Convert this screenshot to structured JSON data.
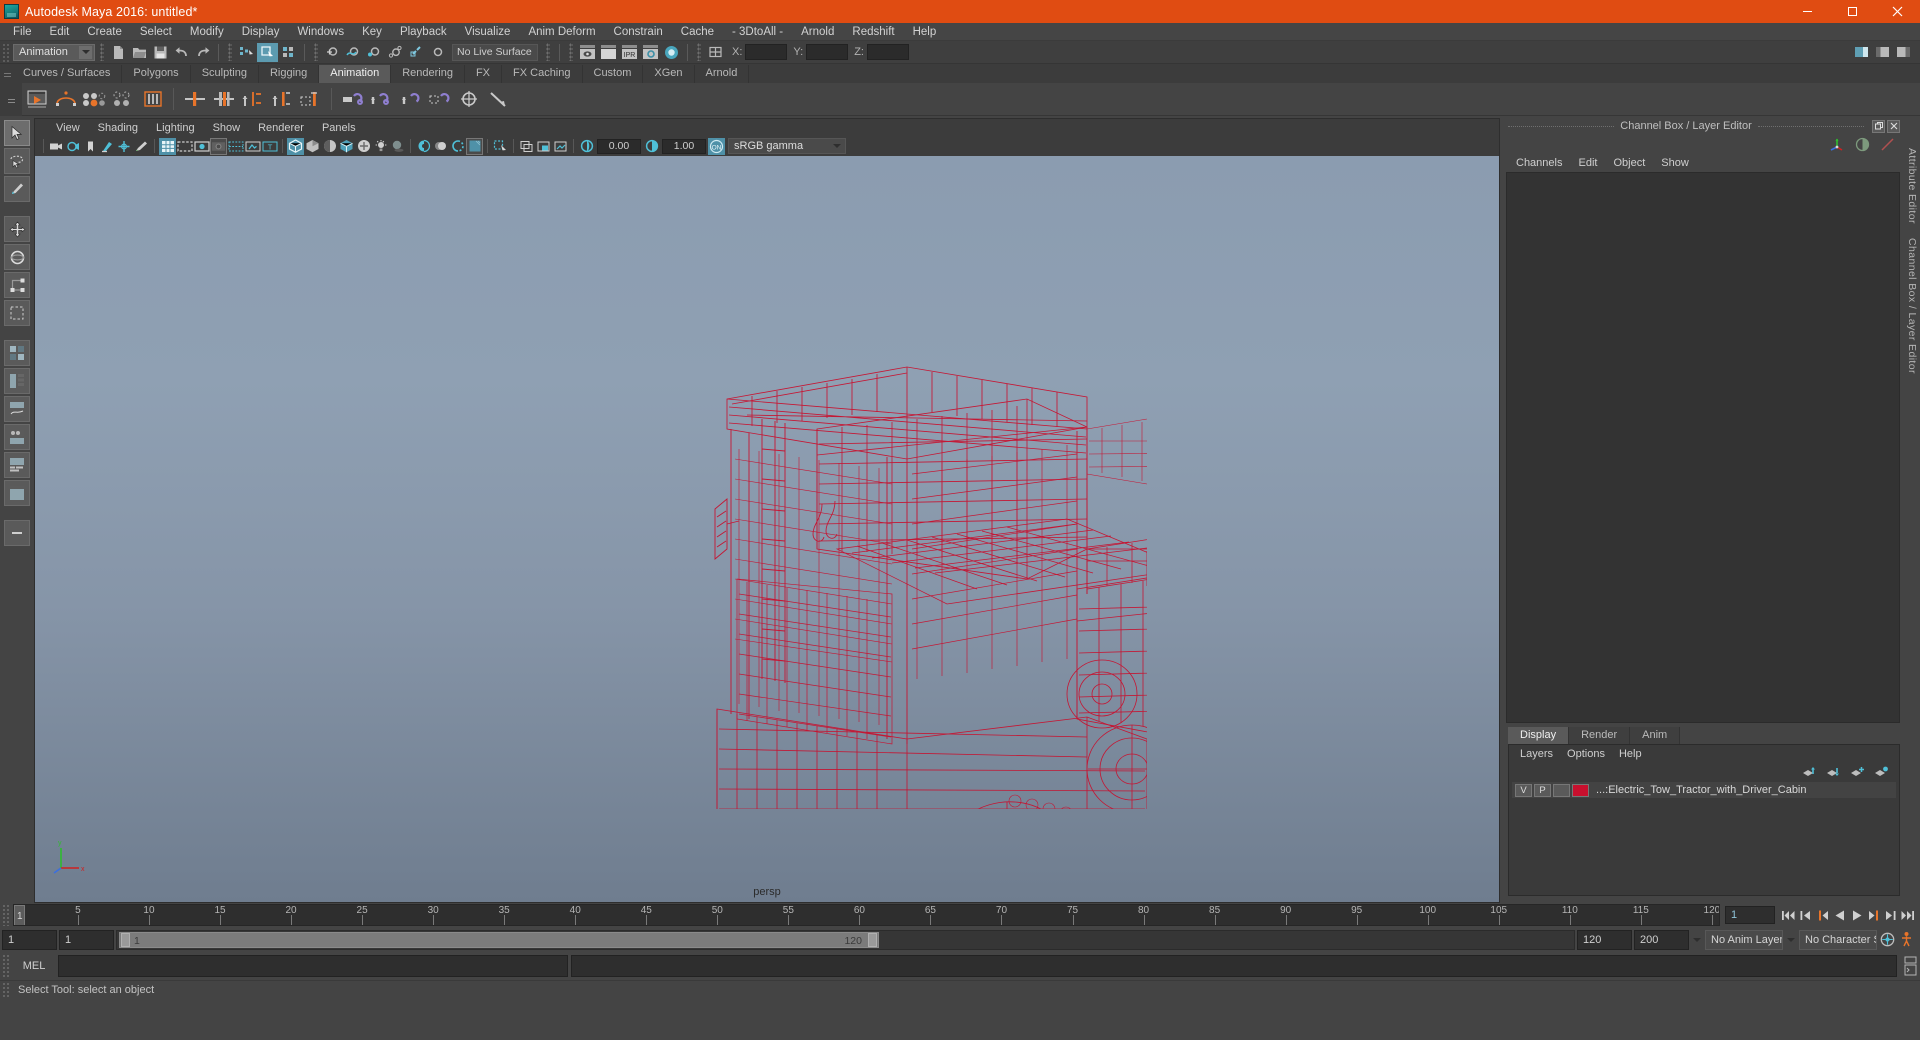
{
  "window": {
    "title": "Autodesk Maya 2016: untitled*",
    "minimize_label": "—",
    "maximize_label": "❐",
    "close_label": "✕"
  },
  "menubar": {
    "items": [
      {
        "label": "File"
      },
      {
        "label": "Edit"
      },
      {
        "label": "Create"
      },
      {
        "label": "Select"
      },
      {
        "label": "Modify"
      },
      {
        "label": "Display"
      },
      {
        "label": "Windows"
      },
      {
        "label": "Key"
      },
      {
        "label": "Playback"
      },
      {
        "label": "Visualize"
      },
      {
        "label": "Anim Deform"
      },
      {
        "label": "Constrain"
      },
      {
        "label": "Cache"
      },
      {
        "label": "- 3DtoAll -"
      },
      {
        "label": "Arnold"
      },
      {
        "label": "Redshift"
      },
      {
        "label": "Help"
      }
    ]
  },
  "statusline": {
    "menuset_value": "Animation",
    "live_surface_value": "No Live Surface",
    "coord_x_label": "X:",
    "coord_y_label": "Y:",
    "coord_z_label": "Z:",
    "coord_x_value": "",
    "coord_y_value": "",
    "coord_z_value": "",
    "ipr_label": "IPR",
    "icons": [
      "new-scene-icon",
      "open-scene-icon",
      "save-scene-icon",
      "undo-icon",
      "redo-icon",
      "select-by-hierarchy-icon",
      "select-by-object-icon",
      "select-by-component-icon",
      "snap-to-grid-icon",
      "snap-to-curve-icon",
      "snap-to-point-icon",
      "snap-to-projected-center-icon",
      "snap-to-view-plane-icon",
      "make-live-icon",
      "render-current-frame-icon",
      "ipr-render-icon",
      "render-settings-icon",
      "hypershade-icon",
      "render-view-icon"
    ]
  },
  "shelf_tabs": {
    "items": [
      {
        "label": "Curves / Surfaces"
      },
      {
        "label": "Polygons"
      },
      {
        "label": "Sculpting"
      },
      {
        "label": "Rigging"
      },
      {
        "label": "Animation"
      },
      {
        "label": "Rendering"
      },
      {
        "label": "FX"
      },
      {
        "label": "FX Caching"
      },
      {
        "label": "Custom"
      },
      {
        "label": "XGen"
      },
      {
        "label": "Arnold"
      }
    ],
    "active": "Animation"
  },
  "shelf_icons": [
    "playblast-icon",
    "ghost-selected-icon",
    "set-key-icon",
    "set-breakdown-key-icon",
    "key-channel-icon",
    "cut-keys-icon",
    "copy-keys-icon",
    "paste-keys-icon",
    "delete-keys-icon",
    "snap-keys-icon",
    "ik-handle-icon",
    "ik-spline-handle-icon",
    "constraint-icon",
    "parent-constraint-icon",
    "point-constraint-icon",
    "orient-constraint-icon",
    "scale-constraint-icon",
    "aim-constraint-icon",
    "pole-vector-icon"
  ],
  "viewport": {
    "menus": [
      {
        "label": "View"
      },
      {
        "label": "Shading"
      },
      {
        "label": "Lighting"
      },
      {
        "label": "Show"
      },
      {
        "label": "Renderer"
      },
      {
        "label": "Panels"
      }
    ],
    "camera_label": "persp",
    "exposure_value": "0.00",
    "gamma_value": "1.00",
    "color_management_value": "sRGB gamma",
    "color_management_toggle": "ON",
    "toolbar_icons": [
      "select-camera-icon",
      "lock-camera-icon",
      "bookmark-icon",
      "image-plane-icon",
      "two-d-pan-zoom-icon",
      "grease-pencil-icon",
      "grid-toggle-icon",
      "film-gate-icon",
      "resolution-gate-icon",
      "gate-mask-icon",
      "field-chart-icon",
      "safe-action-icon",
      "safe-title-icon",
      "wireframe-icon",
      "smooth-shade-icon",
      "flat-shade-icon",
      "shaded-wireframe-icon",
      "textured-icon",
      "lighting-icon",
      "shadows-icon",
      "ambient-occlusion-icon",
      "motion-blur-icon",
      "multisample-icon",
      "isolate-select-icon",
      "xray-icon",
      "xray-joints-icon",
      "xray-active-components-icon",
      "exposure-icon",
      "gamma-icon"
    ],
    "model_name": "Electric Tow Tractor with Driver Cabin",
    "wire_color": "#c8102e"
  },
  "toolbox": {
    "items": [
      {
        "name": "select-tool",
        "label": "Select Tool"
      },
      {
        "name": "lasso-tool",
        "label": "Lasso Select Tool"
      },
      {
        "name": "paint-select-tool",
        "label": "Paint Select Tool"
      },
      {
        "name": "move-tool",
        "label": "Move Tool"
      },
      {
        "name": "rotate-tool",
        "label": "Rotate Tool"
      },
      {
        "name": "scale-tool",
        "label": "Scale Tool"
      },
      {
        "name": "last-tool",
        "label": "Last Tool Used"
      },
      {
        "name": "four-view-layout",
        "label": "Four View"
      },
      {
        "name": "persp-outliner-layout",
        "label": "Persp/Outliner"
      },
      {
        "name": "persp-graph-layout",
        "label": "Persp/Graph"
      },
      {
        "name": "hypershade-persp-layout",
        "label": "Hypershade/Persp"
      },
      {
        "name": "persp-trax-layout",
        "label": "Persp/Trax"
      },
      {
        "name": "single-persp-layout",
        "label": "Single Perspective View"
      },
      {
        "name": "more-layouts",
        "label": "More layouts"
      }
    ]
  },
  "right_panel": {
    "title": "Channel Box / Layer Editor",
    "restore_label": "❐",
    "close_label": "✕",
    "channel_menus": [
      {
        "label": "Channels"
      },
      {
        "label": "Edit"
      },
      {
        "label": "Object"
      },
      {
        "label": "Show"
      }
    ],
    "tool_icons": [
      "show-manipulator-icon",
      "shader-ball-icon",
      "input-line-icon"
    ],
    "layer_tabs": [
      {
        "label": "Display"
      },
      {
        "label": "Render"
      },
      {
        "label": "Anim"
      }
    ],
    "layer_tabs_active": "Display",
    "layer_menus": [
      {
        "label": "Layers"
      },
      {
        "label": "Options"
      },
      {
        "label": "Help"
      }
    ],
    "layer_icons": [
      "move-layer-up-icon",
      "move-layer-down-icon",
      "new-layer-icon",
      "new-layer-from-selected-icon"
    ],
    "layers": [
      {
        "visibility": "V",
        "playback": "P",
        "display_type": "",
        "color": "#c8102e",
        "name": "...:Electric_Tow_Tractor_with_Driver_Cabin"
      }
    ],
    "side_tabs": [
      {
        "label": "Attribute Editor"
      },
      {
        "label": "Channel Box / Layer Editor"
      }
    ]
  },
  "time_slider": {
    "start": 1,
    "end": 120,
    "current_frame": "1",
    "tick_labels": [
      5,
      10,
      15,
      20,
      25,
      30,
      35,
      40,
      45,
      50,
      55,
      60,
      65,
      70,
      75,
      80,
      85,
      90,
      95,
      100,
      105,
      110,
      115,
      120
    ],
    "cursor_label": "1",
    "playback_buttons": [
      {
        "name": "go-to-start-button",
        "glyph": "go-to-start"
      },
      {
        "name": "step-back-frame-button",
        "glyph": "step-back"
      },
      {
        "name": "step-back-key-button",
        "glyph": "step-back-key"
      },
      {
        "name": "play-backwards-button",
        "glyph": "play-back"
      },
      {
        "name": "play-forwards-button",
        "glyph": "play-fwd"
      },
      {
        "name": "step-forward-key-button",
        "glyph": "step-fwd-key"
      },
      {
        "name": "step-forward-frame-button",
        "glyph": "step-fwd"
      },
      {
        "name": "go-to-end-button",
        "glyph": "go-to-end"
      }
    ]
  },
  "range_slider": {
    "anim_start": "1",
    "range_start": "1",
    "range_bar_left_label": "1",
    "range_bar_right_label": "120",
    "range_end": "120",
    "anim_end": "200",
    "anim_layer": "No Anim Layer",
    "character_set": "No Character Set",
    "auto_key_icon": "auto-keyframe-icon",
    "anim_prefs_icon": "animation-preferences-icon"
  },
  "command_line": {
    "language_label": "MEL",
    "input_value": "",
    "output_value": ""
  },
  "help_line": {
    "text": "Select Tool: select an object"
  },
  "colors": {
    "titlebar": "#e04c12",
    "chrome": "#444444",
    "panel_dark": "#2e2e2e",
    "accent_blue": "#5c9bb0",
    "accent_orange": "#e87d3c",
    "wire_red": "#c8102e"
  }
}
